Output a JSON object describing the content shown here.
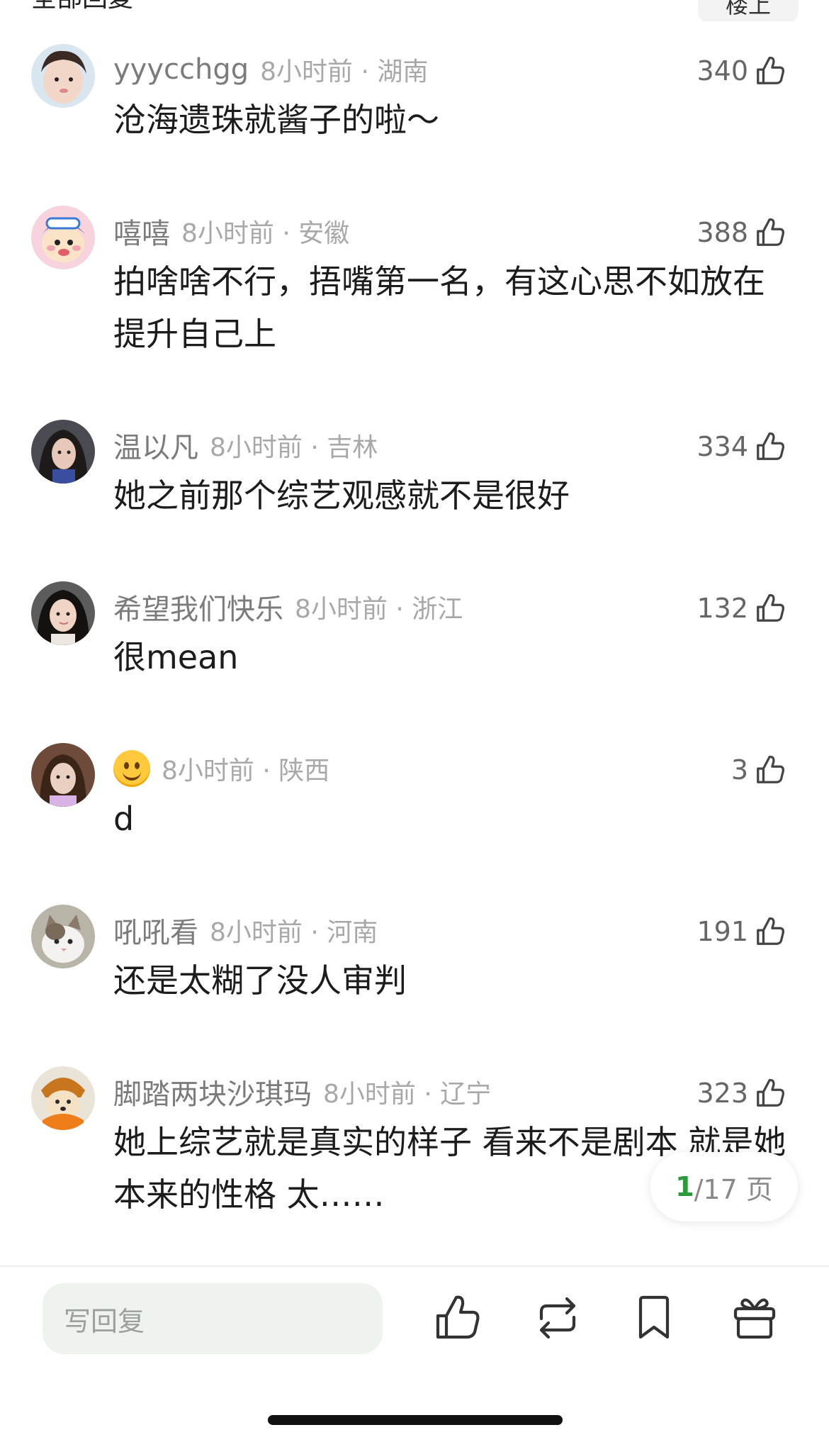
{
  "header": {
    "title": "全部回复",
    "sort_label": "楼上"
  },
  "comments": [
    {
      "username": "yyycchgg",
      "time": "8小时前",
      "location": "湖南",
      "likes": "340",
      "text": "沧海遗珠就酱子的啦～",
      "avatar": "girl-photo-avatar"
    },
    {
      "username": "嘻嘻",
      "time": "8小时前",
      "location": "安徽",
      "likes": "388",
      "text": "拍啥啥不行，捂嘴第一名，有这心思不如放在提升自己上",
      "avatar": "cartoon-avatar"
    },
    {
      "username": "温以凡",
      "time": "8小时前",
      "location": "吉林",
      "likes": "334",
      "text": "她之前那个综艺观感就不是很好",
      "avatar": "girl-photo-avatar"
    },
    {
      "username": "希望我们快乐",
      "time": "8小时前",
      "location": "浙江",
      "likes": "132",
      "text": "很mean",
      "avatar": "girl-photo-avatar"
    },
    {
      "username": "😊",
      "time": "8小时前",
      "location": "陕西",
      "likes": "3",
      "text": "d",
      "avatar": "girl-photo-avatar"
    },
    {
      "username": "吼吼看",
      "time": "8小时前",
      "location": "河南",
      "likes": "191",
      "text": "还是太糊了没人审判",
      "avatar": "cat-avatar"
    },
    {
      "username": "脚踏两块沙琪玛",
      "time": "8小时前",
      "location": "辽宁",
      "likes": "323",
      "text": "她上综艺就是真实的样子 看来不是剧本 就是她本来的性格 太……",
      "avatar": "dog-avatar"
    }
  ],
  "pagination": {
    "current": "1",
    "total": "/17 页"
  },
  "bottom_bar": {
    "reply_placeholder": "写回复",
    "icons": [
      "like-icon",
      "repost-icon",
      "bookmark-icon",
      "gift-icon"
    ]
  },
  "colors": {
    "accent": "#2e9a3c",
    "meta_text": "#a8a8a8",
    "username_text": "#7b7b7b",
    "reply_box_bg": "#eef3ee"
  }
}
